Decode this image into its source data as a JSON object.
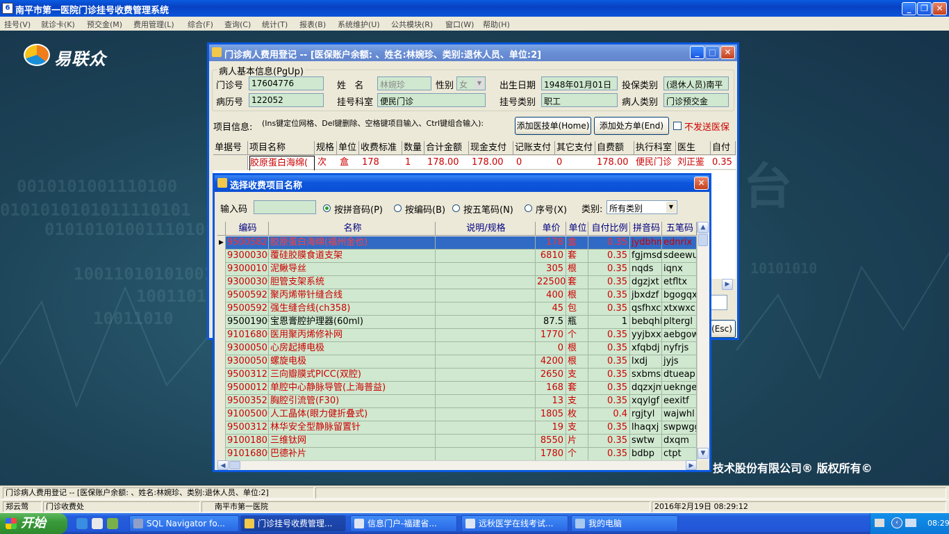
{
  "app_title": "南平市第一医院门诊挂号收费管理系统",
  "menu": [
    "挂号(V)",
    "就诊卡(K)",
    "预交金(M)",
    "费用管理(L)",
    "综合(F)",
    "查询(C)",
    "统计(T)",
    "报表(B)",
    "系统维护(U)",
    "公共模块(R)",
    "窗口(W)",
    "帮助(H)"
  ],
  "logo_text": "易联众",
  "copyright": "技术股份有限公司®  版权所有©",
  "bg_text": [
    "0010101001110100",
    "0101010101011110101",
    "0101010100111010",
    "100110101010010",
    "10011010",
    "10011010",
    "台",
    "10101010"
  ],
  "reg": {
    "title": "门诊病人费用登记 -- [医保账户余额: 、姓名:林婉珍、类别:退休人员、单位:2]",
    "group_label": "病人基本信息(PgUp)",
    "labels": {
      "clinic_no": "门诊号",
      "name": "姓   名",
      "gender": "性别",
      "birth": "出生日期",
      "ins_type": "投保类别",
      "record_no": "病历号",
      "dept": "挂号科室",
      "reg_type": "挂号类别",
      "patient_type": "病人类别"
    },
    "values": {
      "clinic_no": "17604776",
      "name": "林婉珍",
      "gender": "女",
      "birth": "1948年01月01日",
      "ins_type": "(退休人员)南平",
      "record_no": "122052",
      "dept": "便民门诊",
      "reg_type": "职工",
      "patient_type": "门诊预交金"
    },
    "item_info": "项目信息:",
    "item_hint": "(Ins键定位网格、Del键删除、空格键项目输入、Ctrl键组合输入):",
    "btn_add_doc": "添加医技单(Home)",
    "btn_add_rx": "添加处方单(End)",
    "no_send_label": "不发送医保",
    "columns": [
      "单据号",
      "项目名称",
      "规格",
      "单位",
      "收费标准",
      "数量",
      "合计金额",
      "现金支付",
      "记账支付",
      "其它支付",
      "自费额",
      "执行科室",
      "医生",
      "自付"
    ],
    "rows": [
      [
        "",
        "胶原蛋白海绵(",
        "次",
        "盒",
        "178",
        "1",
        "178.00",
        "178.00",
        "0",
        "0",
        "178.00",
        "便民门诊",
        "刘正鉴",
        "0.35"
      ]
    ],
    "esc_fragment": "(Esc)"
  },
  "select": {
    "title": "选择收费项目名称",
    "input_label": "输入码",
    "input_value": "",
    "radios": [
      "按拼音码(P)",
      "按编码(B)",
      "按五笔码(N)",
      "序号(X)"
    ],
    "category_label": "类别:",
    "category_value": "所有类别",
    "columns": [
      "编码",
      "名称",
      "说明/规格",
      "单价",
      "单位",
      "自付比例",
      "拼音码",
      "五笔码"
    ],
    "rows": [
      {
        "code": "95005825",
        "name": "胶原蛋白海绵(福州金也)",
        "spec": "",
        "price": "178",
        "unit": "盒",
        "ratio": "0.35",
        "py": "jydbhm",
        "wb": "ednrix",
        "color": "red",
        "selected": true
      },
      {
        "code": "93000300",
        "name": "覆硅胶膜食道支架",
        "spec": "",
        "price": "6810",
        "unit": "套",
        "ratio": "0.35",
        "py": "fgjmsd",
        "wb": "sdeewu",
        "color": "red"
      },
      {
        "code": "93000101",
        "name": "泥鳅导丝",
        "spec": "",
        "price": "305",
        "unit": "根",
        "ratio": "0.35",
        "py": "nqds",
        "wb": "iqnx",
        "color": "red"
      },
      {
        "code": "93000300",
        "name": "胆管支架系统",
        "spec": "",
        "price": "22500",
        "unit": "套",
        "ratio": "0.35",
        "py": "dgzjxt",
        "wb": "etfltx",
        "color": "red"
      },
      {
        "code": "95005925",
        "name": "聚丙烯带针缝合线",
        "spec": "",
        "price": "400",
        "unit": "根",
        "ratio": "0.35",
        "py": "jbxdzf",
        "wb": "bgogqx",
        "color": "red"
      },
      {
        "code": "95005925",
        "name": "强生缝合线(ch358)",
        "spec": "",
        "price": "45",
        "unit": "包",
        "ratio": "0.35",
        "py": "qsfhxc",
        "wb": "xtxwxc",
        "color": "red"
      },
      {
        "code": "95001900",
        "name": "宝恩膏腔护理器(60ml)",
        "spec": "",
        "price": "87.5",
        "unit": "瓶",
        "ratio": "1",
        "py": "bebqhl",
        "wb": "pltergl",
        "color": "black"
      },
      {
        "code": "91016800",
        "name": "医用聚丙烯修补网",
        "spec": "",
        "price": "1770",
        "unit": "个",
        "ratio": "0.35",
        "py": "yyjbxx",
        "wb": "aebgow",
        "color": "red"
      },
      {
        "code": "93000501",
        "name": "心房起搏电极",
        "spec": "",
        "price": "0",
        "unit": "根",
        "ratio": "0.35",
        "py": "xfqbdj",
        "wb": "nyfrjs",
        "color": "red"
      },
      {
        "code": "93000501",
        "name": "螺旋电极",
        "spec": "",
        "price": "4200",
        "unit": "根",
        "ratio": "0.35",
        "py": "lxdj",
        "wb": "jyjs",
        "color": "red"
      },
      {
        "code": "95003125",
        "name": "三向瓣膜式PICC(双腔)",
        "spec": "",
        "price": "2650",
        "unit": "支",
        "ratio": "0.35",
        "py": "sxbmsp",
        "wb": "dtueap",
        "color": "red"
      },
      {
        "code": "95000126",
        "name": "单腔中心静脉导管(上海普益)",
        "spec": "",
        "price": "168",
        "unit": "套",
        "ratio": "0.35",
        "py": "dqzxjm",
        "wb": "uekngen",
        "color": "red"
      },
      {
        "code": "95003525",
        "name": "胸腔引流管(F30)",
        "spec": "",
        "price": "13",
        "unit": "支",
        "ratio": "0.35",
        "py": "xqylgf",
        "wb": "eexitf",
        "color": "red"
      },
      {
        "code": "91005000",
        "name": "人工晶体(眼力健折叠式)",
        "spec": "",
        "price": "1805",
        "unit": "枚",
        "ratio": "0.4",
        "py": "rgjtyl",
        "wb": "wajwhl",
        "color": "red"
      },
      {
        "code": "95003125",
        "name": "林华安全型静脉留置针",
        "spec": "",
        "price": "19",
        "unit": "支",
        "ratio": "0.35",
        "py": "lhaqxj",
        "wb": "swpwgg",
        "color": "red"
      },
      {
        "code": "91001801",
        "name": "三维钛网",
        "spec": "",
        "price": "8550",
        "unit": "片",
        "ratio": "0.35",
        "py": "swtw",
        "wb": "dxqm",
        "color": "red"
      },
      {
        "code": "91016800",
        "name": "巴德补片",
        "spec": "",
        "price": "1780",
        "unit": "个",
        "ratio": "0.35",
        "py": "bdbp",
        "wb": "ctpt",
        "color": "red"
      }
    ]
  },
  "status": {
    "line1": "门诊病人费用登记 -- [医保账户余额: 、姓名:林婉珍、类别:退休人员、单位:2]",
    "user": "郑云莺",
    "station": "门诊收费处",
    "hospital": "南平市第一医院",
    "datetime": "2016年2月19日 08:29:12"
  },
  "taskbar": {
    "start": "开始",
    "tasks": [
      "SQL Navigator fo...",
      "门诊挂号收费管理...",
      "信息门户-福建省...",
      "远秋医学在线考试...",
      "我的电脑"
    ],
    "clock": "08:29"
  },
  "colors": {
    "red_text": "#cc0000",
    "grid_bg": "#cfe8cf",
    "selected_bg": "#316ac5",
    "title_blue": "#0a54d8"
  }
}
